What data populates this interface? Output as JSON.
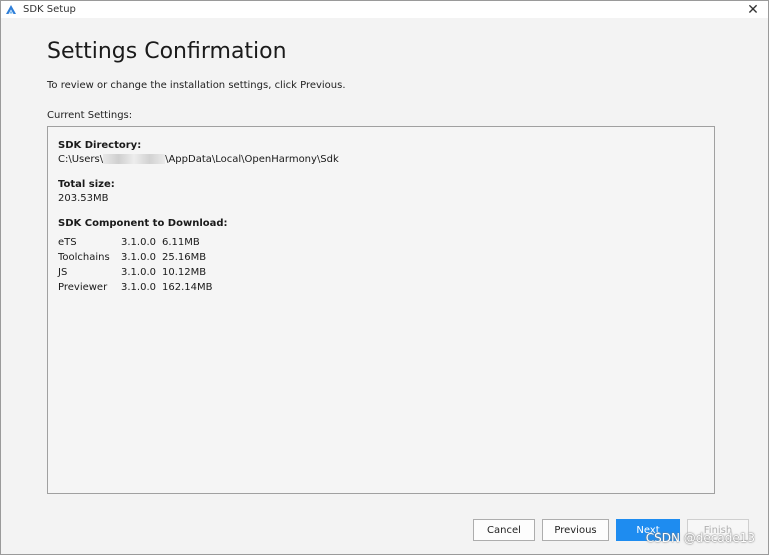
{
  "window": {
    "title": "SDK Setup",
    "app_icon": "app-logo-icon",
    "close_glyph": "✕"
  },
  "page": {
    "heading": "Settings Confirmation",
    "instruction": "To review or change the installation settings, click Previous.",
    "current_settings_label": "Current Settings:"
  },
  "settings": {
    "sdk_directory_title": "SDK Directory:",
    "sdk_directory_prefix": "C:\\Users\\",
    "sdk_directory_suffix": "\\AppData\\Local\\OpenHarmony\\Sdk",
    "total_size_title": "Total size:",
    "total_size_value": "203.53MB",
    "components_title": "SDK Component to Download:",
    "components": [
      {
        "name": "eTS",
        "version": "3.1.0.0",
        "size": "6.11MB"
      },
      {
        "name": "Toolchains",
        "version": "3.1.0.0",
        "size": "25.16MB"
      },
      {
        "name": "JS",
        "version": "3.1.0.0",
        "size": "10.12MB"
      },
      {
        "name": "Previewer",
        "version": "3.1.0.0",
        "size": "162.14MB"
      }
    ]
  },
  "buttons": {
    "cancel": "Cancel",
    "previous": "Previous",
    "next": "Next",
    "finish": "Finish"
  },
  "watermark": "CSDN @decade13",
  "colors": {
    "accent": "#1e8cf0",
    "window_bg": "#f3f3f3"
  }
}
